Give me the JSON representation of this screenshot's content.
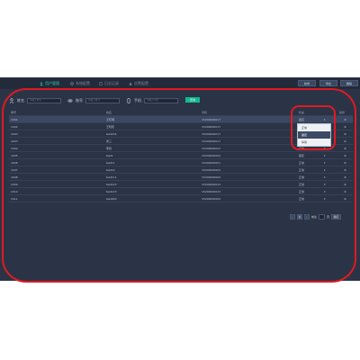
{
  "tabs": [
    {
      "label": "用户管理",
      "icon": "user-icon",
      "active": true
    },
    {
      "label": "系统配置",
      "icon": "gear-icon",
      "active": false
    },
    {
      "label": "日志记录",
      "icon": "log-icon",
      "active": false
    },
    {
      "label": "告警配置",
      "icon": "alert-icon",
      "active": false
    }
  ],
  "top_buttons": [
    "新增",
    "导出",
    "删除"
  ],
  "filters": {
    "name": {
      "label": "姓名",
      "placeholder": "请输入姓名",
      "icon": "person-icon"
    },
    "account": {
      "label": "账号",
      "placeholder": "请输入账号",
      "icon": "link-icon"
    },
    "phone": {
      "label": "手机",
      "placeholder": "请输入手机",
      "icon": "phone-icon"
    },
    "query_label": "查询"
  },
  "table": {
    "headers": [
      "账号",
      "姓名",
      "手机",
      "状态",
      "",
      "操作"
    ],
    "rows": [
      {
        "account": "1001",
        "name": "王晓明",
        "phone": "15200000017",
        "status": "锁定",
        "status_key": "locked",
        "action": "⚙"
      },
      {
        "account": "1002",
        "name": "王晓晓",
        "phone": "15200000017",
        "status": "正常",
        "status_key": "normal",
        "action": "⚙"
      },
      {
        "account": "1003",
        "name": "test234",
        "phone": "15200000017",
        "status": "正常",
        "status_key": "normal",
        "action": "⚙"
      },
      {
        "account": "1003",
        "name": "张三",
        "phone": "15200000017",
        "status": "正常",
        "status_key": "normal",
        "action": "⚙"
      },
      {
        "account": "1004",
        "name": "李四",
        "phone": "15200000022",
        "status": "正常",
        "status_key": "normal",
        "action": "⚙"
      },
      {
        "account": "1005",
        "name": "test1",
        "phone": "15200000003",
        "status": "锁定",
        "status_key": "locked",
        "action": "⚙"
      },
      {
        "account": "1006",
        "name": "test11",
        "phone": "15200000001",
        "status": "正常",
        "status_key": "normal",
        "action": "⚙"
      },
      {
        "account": "1007",
        "name": "test10",
        "phone": "15200000003",
        "status": "正常",
        "status_key": "normal",
        "action": "⚙"
      },
      {
        "account": "1008",
        "name": "test111",
        "phone": "15200000009",
        "status": "正常",
        "status_key": "normal",
        "action": "⚙"
      },
      {
        "account": "1009",
        "name": "test123",
        "phone": "15200000013",
        "status": "正常",
        "status_key": "normal",
        "action": "⚙"
      },
      {
        "account": "1010",
        "name": "test123",
        "phone": "15200000043",
        "status": "正常",
        "status_key": "normal",
        "action": "⚙"
      },
      {
        "account": "1011",
        "name": "test000",
        "phone": "15200000000",
        "status": "正常",
        "status_key": "normal",
        "action": "⚙"
      }
    ]
  },
  "status_dropdown": {
    "options": [
      "正常",
      "锁定",
      "停用"
    ],
    "highlighted": "锁定"
  },
  "pagination": {
    "prev": "‹",
    "pages": [
      "1"
    ],
    "current": "1",
    "next": "›",
    "goto_label": "前往",
    "page_unit": "页",
    "confirm": "确定"
  },
  "colors": {
    "accent": "#20d0a8",
    "status_normal": "#3ce08a",
    "status_locked": "#e9a63a",
    "annotation": "#e01a22",
    "panel_bg": "#2b3446",
    "header_bg": "#232b3b"
  }
}
